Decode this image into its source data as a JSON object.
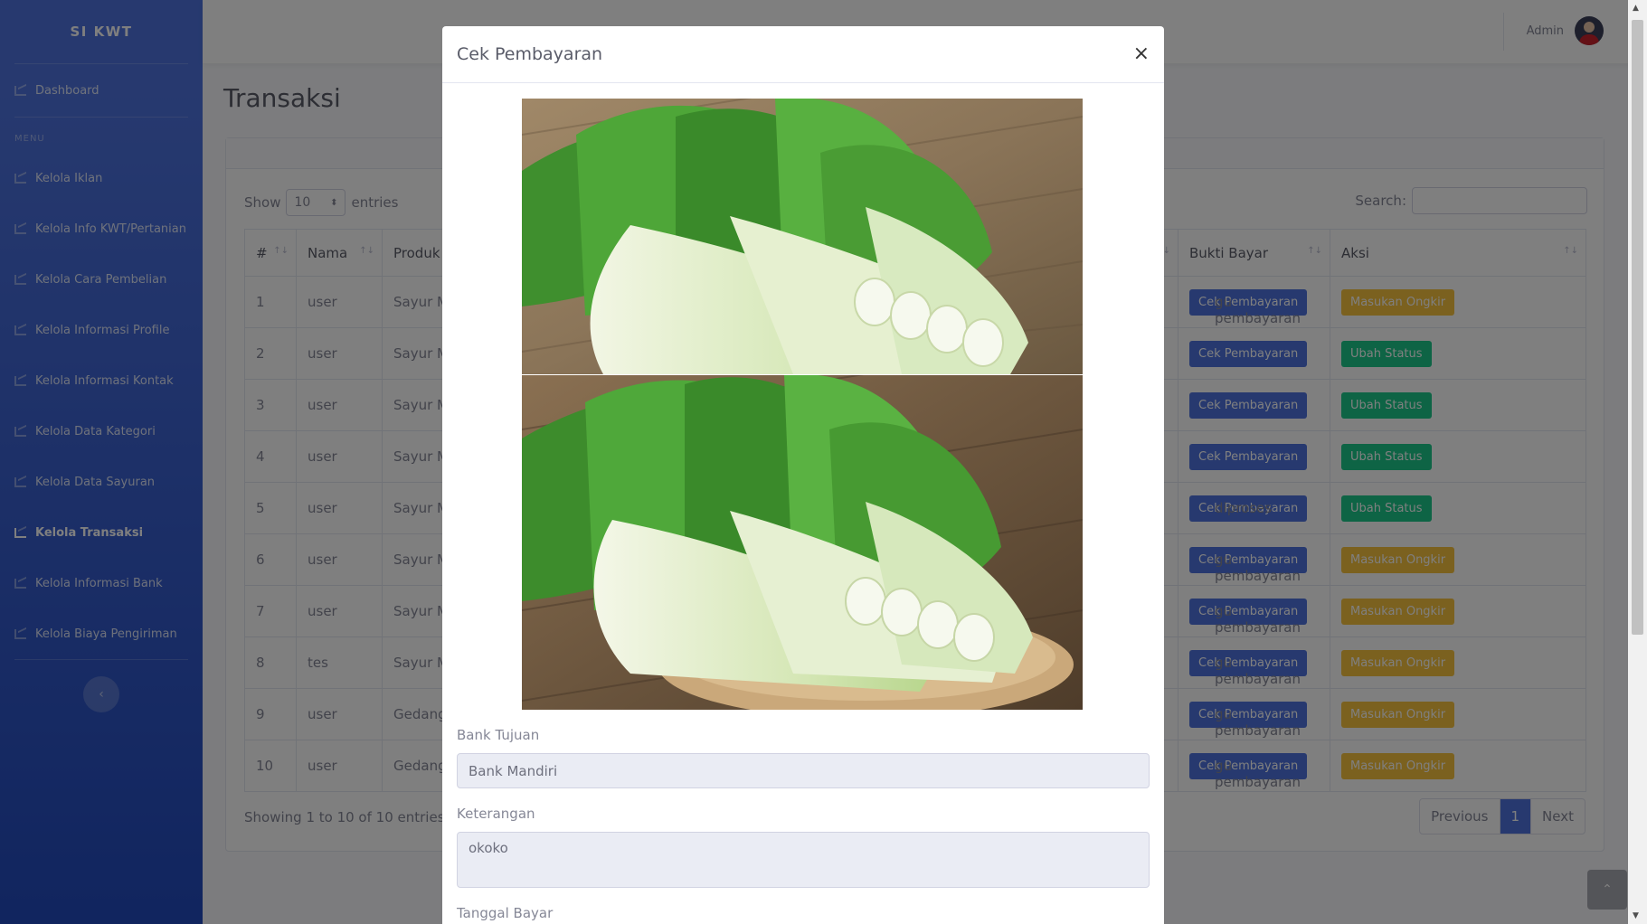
{
  "sidebar": {
    "brand": "SI KWT",
    "dashboard": "Dashboard",
    "heading": "MENU",
    "items": [
      {
        "label": "Kelola Iklan"
      },
      {
        "label": "Kelola Info KWT/Pertanian"
      },
      {
        "label": "Kelola Cara Pembelian"
      },
      {
        "label": "Kelola Informasi Profile"
      },
      {
        "label": "Kelola Informasi Kontak"
      },
      {
        "label": "Kelola Data Kategori"
      },
      {
        "label": "Kelola Data Sayuran"
      },
      {
        "label": "Kelola Transaksi"
      },
      {
        "label": "Kelola Informasi Bank"
      },
      {
        "label": "Kelola Biaya Pengiriman"
      }
    ],
    "toggle_icon": "‹"
  },
  "topbar": {
    "user": "Admin"
  },
  "page": {
    "title": "Transaksi"
  },
  "table": {
    "show_label": "Show",
    "entries_value": "10",
    "entries_label": "entries",
    "search_label": "Search:",
    "headers": {
      "num": "#",
      "nama": "Nama",
      "produk": "Produk",
      "bukti": "Bukti Bayar",
      "aksi": "Aksi"
    },
    "sort_icon": "↑↓",
    "rows": [
      {
        "num": "1",
        "nama": "user",
        "produk": "Sayur M",
        "status": "gu pembayaran",
        "btn1": "Cek Pembayaran",
        "btn2": "Masukan Ongkir",
        "btn2_type": "warning"
      },
      {
        "num": "2",
        "nama": "user",
        "produk": "Sayur M",
        "status": "",
        "btn1": "Cek Pembayaran",
        "btn2": "Ubah Status",
        "btn2_type": "success"
      },
      {
        "num": "3",
        "nama": "user",
        "produk": "Sayur M",
        "status": "",
        "btn1": "Cek Pembayaran",
        "btn2": "Ubah Status",
        "btn2_type": "success"
      },
      {
        "num": "4",
        "nama": "user",
        "produk": "Sayur M",
        "status": "",
        "btn1": "Cek Pembayaran",
        "btn2": "Ubah Status",
        "btn2_type": "success"
      },
      {
        "num": "5",
        "nama": "user",
        "produk": "Sayur M",
        "status": "diproses",
        "btn1": "Cek Pembayaran",
        "btn2": "Ubah Status",
        "btn2_type": "success"
      },
      {
        "num": "6",
        "nama": "user",
        "produk": "Sayur M",
        "status": "gu pembayaran",
        "btn1": "Cek Pembayaran",
        "btn2": "Masukan Ongkir",
        "btn2_type": "warning"
      },
      {
        "num": "7",
        "nama": "user",
        "produk": "Sayur M",
        "status": "gu pembayaran",
        "btn1": "Cek Pembayaran",
        "btn2": "Masukan Ongkir",
        "btn2_type": "warning"
      },
      {
        "num": "8",
        "nama": "tes",
        "produk": "Sayur M",
        "status": "gu pembayaran",
        "btn1": "Cek Pembayaran",
        "btn2": "Masukan Ongkir",
        "btn2_type": "warning"
      },
      {
        "num": "9",
        "nama": "user",
        "produk": "Gedang",
        "status": "gu pembayaran",
        "btn1": "Cek Pembayaran",
        "btn2": "Masukan Ongkir",
        "btn2_type": "warning"
      },
      {
        "num": "10",
        "nama": "user",
        "produk": "Gedang",
        "status": "gu pembayaran",
        "btn1": "Cek Pembayaran",
        "btn2": "Masukan Ongkir",
        "btn2_type": "warning"
      }
    ],
    "showing": "Showing 1 to 10 of 10 entries",
    "pagination": {
      "prev": "Previous",
      "current": "1",
      "next": "Next"
    }
  },
  "modal": {
    "title": "Cek Pembayaran",
    "close": "×",
    "bank_label": "Bank Tujuan",
    "bank_value": "Bank Mandiri",
    "ket_label": "Keterangan",
    "ket_value": "okoko",
    "tanggal_label": "Tanggal Bayar"
  },
  "icons": {
    "scroll_top": "⌃",
    "scroll_up": "▲",
    "scroll_down": "▼",
    "select_arrow": "⬍"
  },
  "colors": {
    "primary": "#4e73df",
    "success": "#1cc88a",
    "warning": "#f6c23e"
  }
}
